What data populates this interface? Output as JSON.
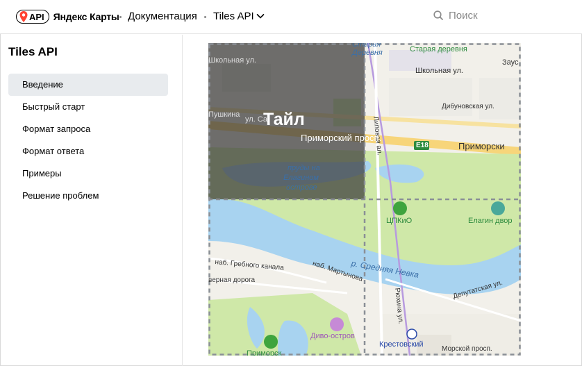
{
  "header": {
    "logo_badge": "API",
    "brand": "Яндекс Карты",
    "breadcrumb": [
      "Документация",
      "Tiles API"
    ],
    "search_placeholder": "Поиск"
  },
  "sidebar": {
    "title": "Tiles API",
    "items": [
      {
        "label": "Введение",
        "active": true
      },
      {
        "label": "Быстрый старт",
        "active": false
      },
      {
        "label": "Формат запроса",
        "active": false
      },
      {
        "label": "Формат ответа",
        "active": false
      },
      {
        "label": "Примеры",
        "active": false
      },
      {
        "label": "Решение проблем",
        "active": false
      }
    ]
  },
  "map": {
    "tile_label": "Тайл",
    "labels": {
      "staraya_derevnya_top": "Старая",
      "derevnya": "Деревня",
      "staraya_derevnya_station": "Старая деревня",
      "zaus": "Заус",
      "shkolnaya_left": "Школьная ул.",
      "shkolnaya": "Школьная ул.",
      "lipovaya": "Липовая ал.",
      "dibunovskaya": "Дибуновская ул.",
      "pushkina": "Пушкина",
      "ul_sa": "ул. Са",
      "primorsky_left": "Приморский просп.",
      "e18": "E18",
      "primorsky_right": "Приморски",
      "prudy1": "пруды на",
      "prudy2": "Елагином",
      "prudy3": "острове",
      "tspkio": "ЦПКиО",
      "elagin": "Елагин двор",
      "nab_grebnogo": "наб. Гребного канала",
      "nab_martynova": "наб. Мартынова",
      "sr_nevka": "р. Средняя Невка",
      "vernaya": "верная дорога",
      "roxina": "Рюхина ул.",
      "deputatskaya": "Депутатская ул.",
      "divo": "Диво-остров",
      "krestovsky": "Крестовский",
      "morskoy": "Морской просп.",
      "primorsk_bottom": "Приморск"
    }
  },
  "colors": {
    "active_bg": "#e8ebee",
    "water": "#a8d3f0",
    "park": "#cfe8a8",
    "tile_overlay": "#3a3a3a"
  }
}
